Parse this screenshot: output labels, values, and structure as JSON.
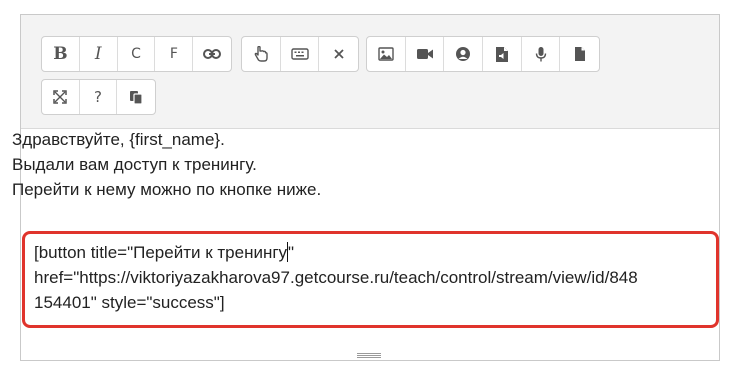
{
  "toolbar": {
    "row1": [
      {
        "icon": "bold-icon",
        "glyph": "B"
      },
      {
        "icon": "italic-icon",
        "glyph": "I"
      },
      {
        "icon": "color-icon",
        "glyph": "C"
      },
      {
        "icon": "font-icon",
        "glyph": "F"
      },
      {
        "icon": "link-icon"
      }
    ],
    "help_glyph": "?"
  },
  "content": {
    "line1": "Здравствуйте, {first_name}.",
    "line2": "Выдали вам доступ к тренингу.",
    "line3": "Перейти к нему можно по кнопке ниже."
  },
  "shortcode": {
    "part1": "[button title=\"Перейти к тренингу",
    "part2": "\"",
    "line2": "href=\"https://viktoriyazakharova97.getcourse.ru/teach/control/stream/view/id/848",
    "line3": "154401\" style=\"success\"]"
  },
  "colors": {
    "highlight_border": "#e0342c",
    "toolbar_bg": "#f3f3f3"
  }
}
